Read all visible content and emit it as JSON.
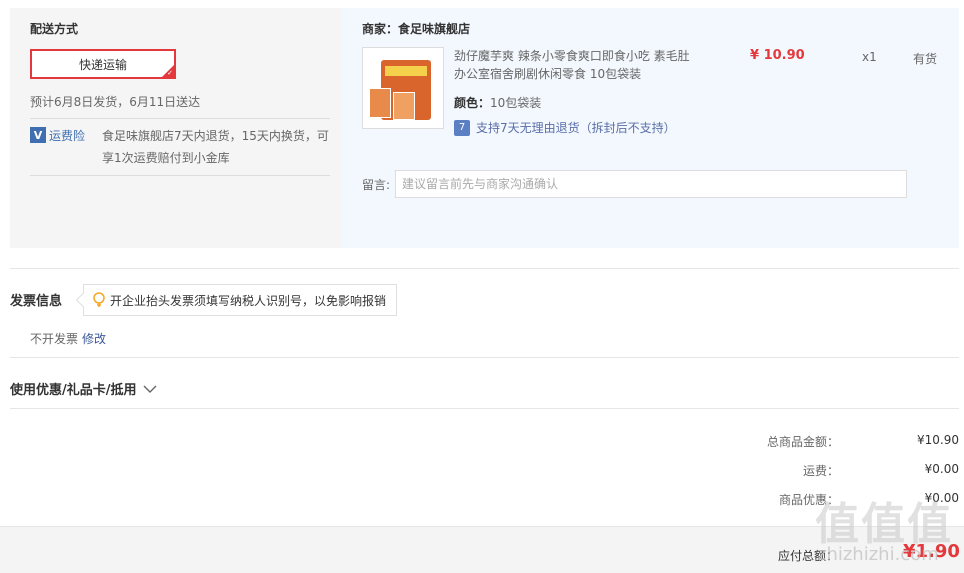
{
  "shipping": {
    "title": "配送方式",
    "option_label": "快递运输",
    "estimate": "预计6月8日发货，6月11日送达",
    "insurance_label": "运费险",
    "insurance_text": "食足味旗舰店7天内退货，15天内换货，可享1次运费赔付到小金库"
  },
  "merchant": {
    "title": "商家：食足味旗舰店",
    "product": {
      "name": "劲仔魔芋爽 辣条小零食爽口即食小吃 素毛肚 办公室宿舍刷剧休闲零食 10包袋装",
      "price": "¥ 10.90",
      "quantity": "x1",
      "stock": "有货",
      "color_key": "颜色：",
      "color_value": "10包袋装",
      "return_policy": "支持7天无理由退货（拆封后不支持）"
    },
    "remark": {
      "label": "留言:",
      "placeholder": "建议留言前先与商家沟通确认"
    }
  },
  "invoice": {
    "title": "发票信息",
    "tip": "开企业抬头发票须填写纳税人识别号，以免影响报销",
    "status": "不开发票",
    "edit_label": "修改"
  },
  "coupon": {
    "title": "使用优惠/礼品卡/抵用"
  },
  "summary": {
    "total_label": "总商品金额：",
    "total_value": "¥10.90",
    "shipping_label": "运费：",
    "shipping_value": "¥0.00",
    "discount_label": "商品优惠：",
    "discount_value": "¥0.00",
    "pay_label": "应付总额：",
    "pay_value": "¥1.90"
  },
  "watermark": {
    "logo": "值值值",
    "site": "zhizhizhi.com"
  },
  "colors": {
    "accent": "#e4393c",
    "link": "#3b5998",
    "merchant_bg": "#f3f8fe",
    "delivery_bg": "#f5f5f5"
  }
}
